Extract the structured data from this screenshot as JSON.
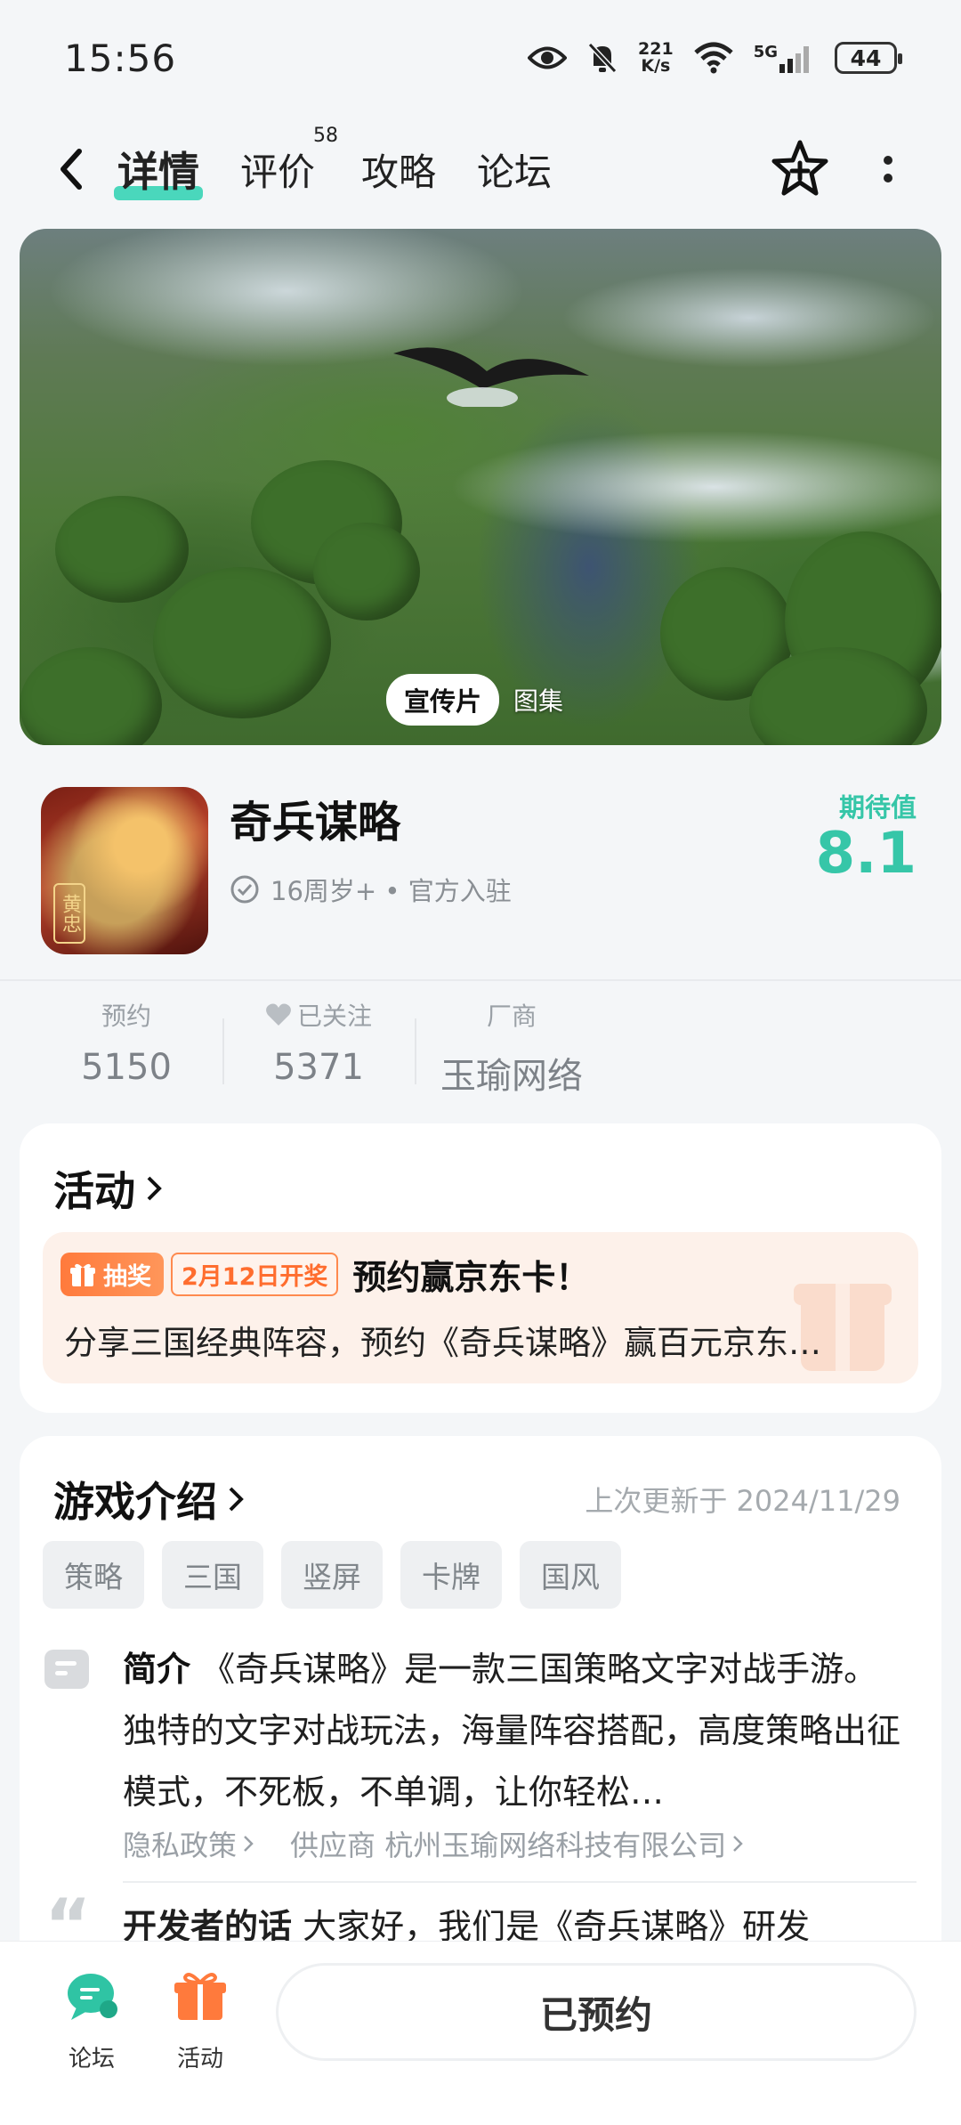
{
  "status_bar": {
    "time": "15:56",
    "net_speed_value": "221",
    "net_speed_unit": "K/s",
    "network": "5G",
    "battery": "44"
  },
  "nav": {
    "tabs": [
      {
        "label": "详情",
        "active": true
      },
      {
        "label": "评价",
        "badge": "58"
      },
      {
        "label": "攻略"
      },
      {
        "label": "论坛"
      }
    ]
  },
  "banner": {
    "pill_video": "宣传片",
    "pill_gallery": "图集"
  },
  "game": {
    "title": "奇兵谋略",
    "icon_seal": "黄忠",
    "meta": "16周岁+ • 官方入驻",
    "score_label": "期待值",
    "score": "8.1"
  },
  "stats": [
    {
      "label": "预约",
      "value": "5150"
    },
    {
      "label": "已关注",
      "value": "5371"
    },
    {
      "label": "厂商",
      "value": "玉瑜网络"
    }
  ],
  "activity": {
    "title": "活动",
    "badge_lottery": "抽奖",
    "badge_date": "2月12日开奖",
    "headline": "预约赢京东卡！",
    "desc": "分享三国经典阵容，预约《奇兵谋略》赢百元京东…"
  },
  "intro": {
    "title": "游戏介绍",
    "updated": "上次更新于 2024/11/29",
    "tags": [
      "策略",
      "三国",
      "竖屏",
      "卡牌",
      "国风"
    ],
    "summary_label": "简介",
    "summary": "《奇兵谋略》是一款三国策略文字对战手游。 独特的文字对战玩法，海量阵容搭配，高度策略出征模式，不死板，不单调，让你轻松…",
    "privacy_link": "隐私政策",
    "supplier_link": "供应商 杭州玉瑜网络科技有限公司",
    "dev_label": "开发者的话",
    "dev_text": "大家好，我们是《奇兵谋略》研发"
  },
  "bottom": {
    "forum": "论坛",
    "activity": "活动",
    "reserve_button": "已预约"
  },
  "colors": {
    "accent": "#36c6a8",
    "orange": "#ff7a3c"
  }
}
